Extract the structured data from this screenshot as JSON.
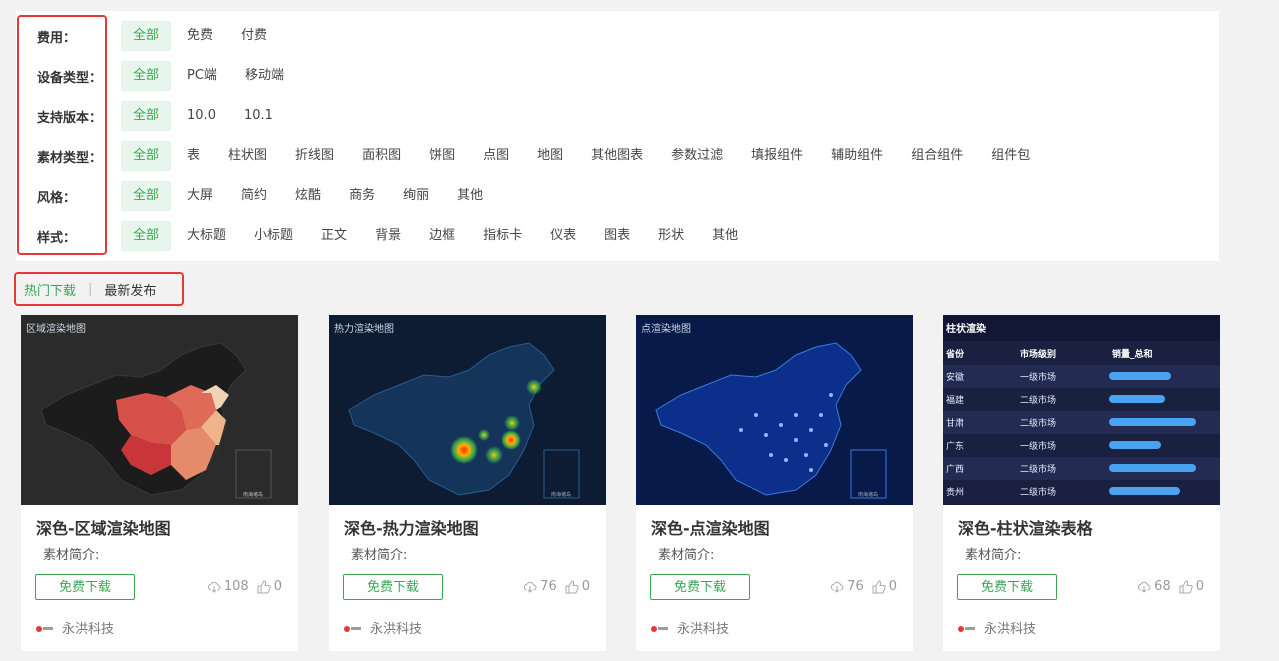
{
  "filters": [
    {
      "label": "费用：",
      "options": [
        "全部",
        "免费",
        "付费"
      ]
    },
    {
      "label": "设备类型：",
      "options": [
        "全部",
        "PC端",
        "移动端"
      ]
    },
    {
      "label": "支持版本：",
      "options": [
        "全部",
        "10.0",
        "10.1"
      ]
    },
    {
      "label": "素材类型：",
      "options": [
        "全部",
        "表",
        "柱状图",
        "折线图",
        "面积图",
        "饼图",
        "点图",
        "地图",
        "其他图表",
        "参数过滤",
        "填报组件",
        "辅助组件",
        "组合组件",
        "组件包"
      ]
    },
    {
      "label": "风格：",
      "options": [
        "全部",
        "大屏",
        "简约",
        "炫酷",
        "商务",
        "绚丽",
        "其他"
      ]
    },
    {
      "label": "样式：",
      "options": [
        "全部",
        "大标题",
        "小标题",
        "正文",
        "背景",
        "边框",
        "指标卡",
        "仪表",
        "图表",
        "形状",
        "其他"
      ]
    }
  ],
  "sort": {
    "hot": "热门下载",
    "separator": "|",
    "latest": "最新发布"
  },
  "cards": [
    {
      "thumb_label": "区域渲染地图",
      "title": "深色-区域渲染地图",
      "desc": "素材简介:",
      "download": "免费下载",
      "downloads": "108",
      "likes": "0",
      "author": "永洪科技"
    },
    {
      "thumb_label": "热力渲染地图",
      "title": "深色-热力渲染地图",
      "desc": "素材简介:",
      "download": "免费下载",
      "downloads": "76",
      "likes": "0",
      "author": "永洪科技"
    },
    {
      "thumb_label": "点渲染地图",
      "title": "深色-点渲染地图",
      "desc": "素材简介:",
      "download": "免费下载",
      "downloads": "76",
      "likes": "0",
      "author": "永洪科技"
    },
    {
      "thumb_label": "柱状渲染",
      "title": "深色-柱状渲染表格",
      "desc": "素材简介:",
      "download": "免费下载",
      "downloads": "68",
      "likes": "0",
      "author": "永洪科技",
      "table": {
        "headers": [
          "省份",
          "市场级别",
          "销量_总和"
        ],
        "rows": [
          {
            "province": "安徽",
            "level": "一级市场",
            "value": 0.62
          },
          {
            "province": "福建",
            "level": "二级市场",
            "value": 0.56
          },
          {
            "province": "甘肃",
            "level": "二级市场",
            "value": 0.87
          },
          {
            "province": "广东",
            "level": "一级市场",
            "value": 0.52
          },
          {
            "province": "广西",
            "level": "二级市场",
            "value": 0.87
          },
          {
            "province": "贵州",
            "level": "二级市场",
            "value": 0.71
          }
        ]
      }
    }
  ],
  "colors": {
    "accent": "#3aa655",
    "highlight_box": "#e53935",
    "active_bg": "#e8f5ec"
  }
}
